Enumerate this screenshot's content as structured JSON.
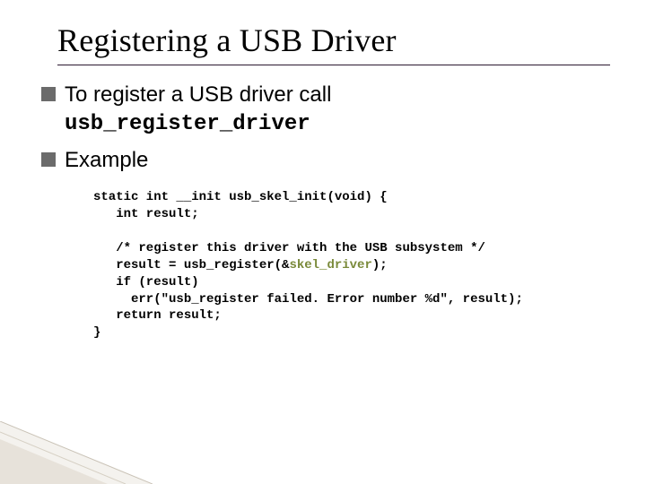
{
  "title": "Registering a USB Driver",
  "bullets": [
    {
      "text": "To register a USB driver call ",
      "mono": "usb_register_driver"
    },
    {
      "text": "Example",
      "mono": ""
    }
  ],
  "code": {
    "l1": "static int __init usb_skel_init(void) {",
    "l2": "   int result;",
    "l3": "",
    "l4": "   /* register this driver with the USB subsystem */",
    "l5a": "   result = usb_register(&",
    "l5b": "skel_driver",
    "l5c": ");",
    "l6": "   if (result)",
    "l7": "     err(\"usb_register failed. Error number %d\", result);",
    "l8": "   return result;",
    "l9": "}"
  }
}
